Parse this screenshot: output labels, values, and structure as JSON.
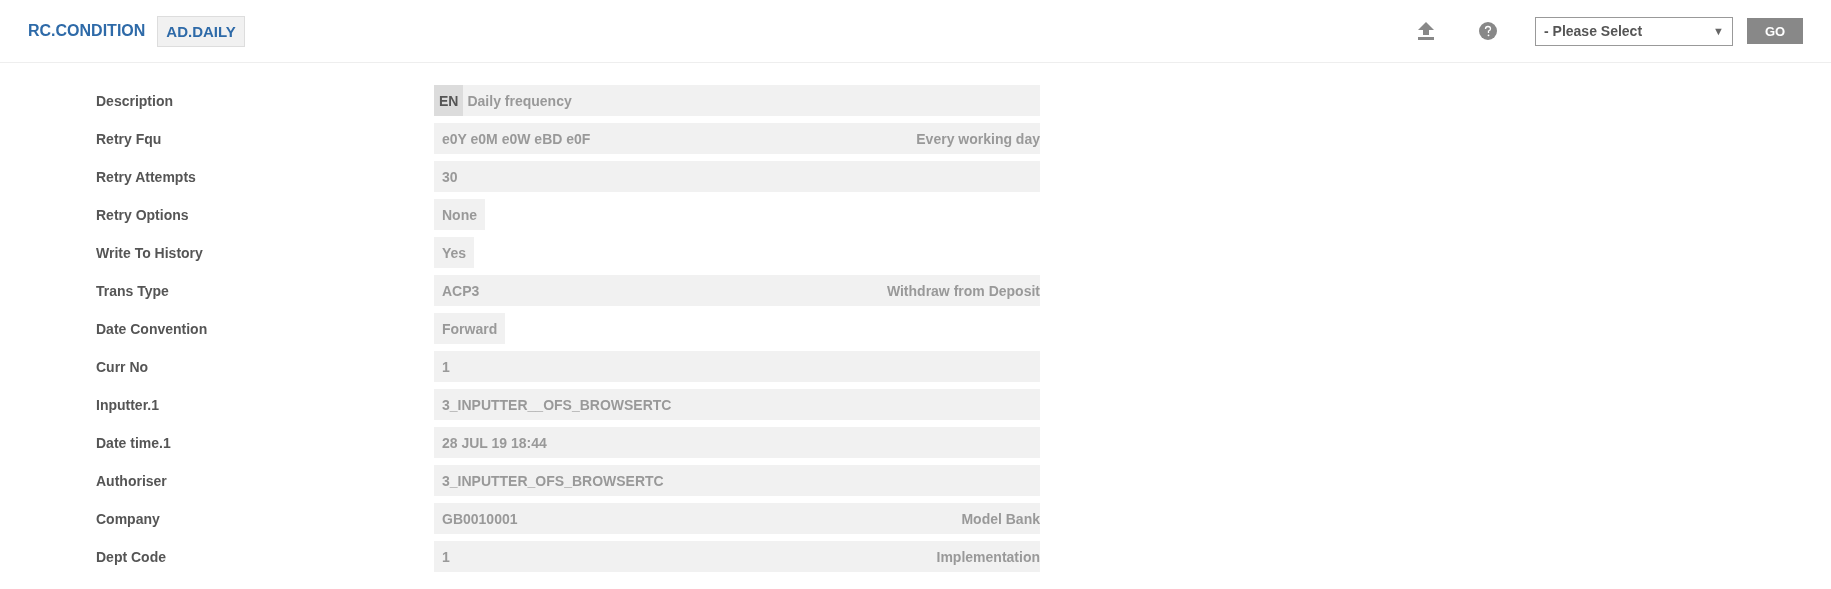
{
  "header": {
    "application": "RC.CONDITION",
    "record_id": "AD.DAILY",
    "select": {
      "value": "- Please Select",
      "arrow": "▼"
    },
    "go_button": "GO"
  },
  "fields": [
    {
      "label": "Description",
      "kind": "lang",
      "lang": "EN",
      "value": "Daily frequency"
    },
    {
      "label": "Retry Fqu",
      "kind": "full",
      "value": "e0Y e0M e0W eBD e0F",
      "enrichment": "Every working day"
    },
    {
      "label": "Retry Attempts",
      "kind": "full",
      "value": "30"
    },
    {
      "label": "Retry Options",
      "kind": "short",
      "value": "None"
    },
    {
      "label": "Write To History",
      "kind": "short",
      "value": "Yes"
    },
    {
      "label": "Trans Type",
      "kind": "full",
      "value": "ACP3",
      "enrichment": "Withdraw from Deposit"
    },
    {
      "label": "Date Convention",
      "kind": "short",
      "value": "Forward"
    },
    {
      "label": "Curr No",
      "kind": "full",
      "value": "1"
    },
    {
      "label": "Inputter.1",
      "kind": "full",
      "value": "3_INPUTTER__OFS_BROWSERTC"
    },
    {
      "label": "Date time.1",
      "kind": "full",
      "value": "28 JUL 19 18:44"
    },
    {
      "label": "Authoriser",
      "kind": "full",
      "value": "3_INPUTTER_OFS_BROWSERTC"
    },
    {
      "label": "Company",
      "kind": "full",
      "value": "GB0010001",
      "enrichment": "Model Bank"
    },
    {
      "label": "Dept Code",
      "kind": "full",
      "value": "1",
      "enrichment": "Implementation"
    }
  ]
}
